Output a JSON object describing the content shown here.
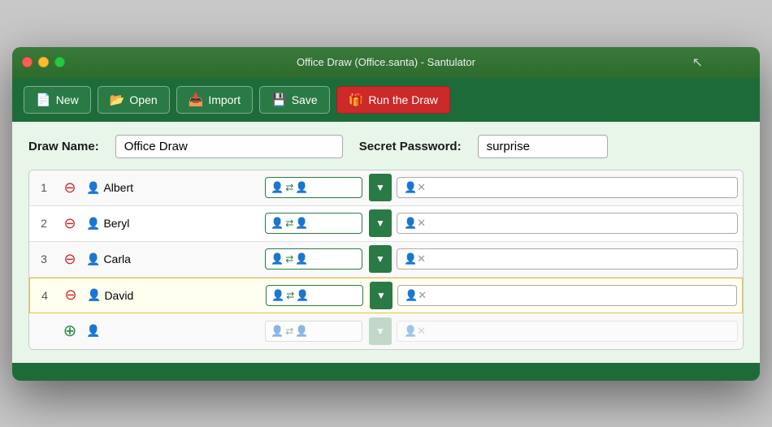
{
  "window": {
    "title": "Office Draw (Office.santa) - Santulator"
  },
  "toolbar": {
    "new_label": "New",
    "open_label": "Open",
    "import_label": "Import",
    "save_label": "Save",
    "run_label": "Run the Draw"
  },
  "form": {
    "draw_name_label": "Draw Name:",
    "draw_name_value": "Office Draw",
    "password_label": "Secret Password:",
    "password_value": "surprise"
  },
  "participants": [
    {
      "number": "1",
      "name": "Albert"
    },
    {
      "number": "2",
      "name": "Beryl"
    },
    {
      "number": "3",
      "name": "Carla"
    },
    {
      "number": "4",
      "name": "David"
    }
  ]
}
